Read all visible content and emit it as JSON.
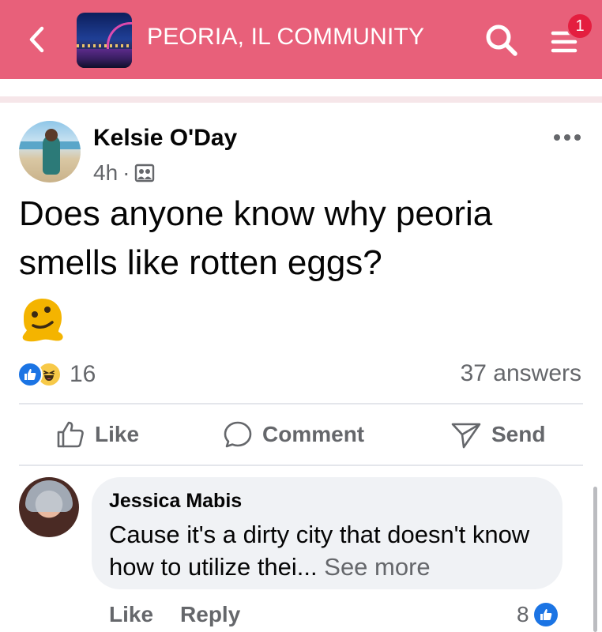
{
  "header": {
    "group_name": "PEORIA, IL COMMUNITY",
    "notification_count": "1",
    "back_icon": "chevron-left-icon",
    "search_icon": "search-icon",
    "menu_icon": "menu-icon",
    "bar_color": "#e8607a"
  },
  "post": {
    "author": "Kelsie O'Day",
    "time": "4h",
    "separator": "·",
    "privacy_icon": "group-members-icon",
    "more_icon": "more-dots-icon",
    "text": "Does anyone know why peoria smells like rotten eggs?",
    "emoji": "melting-face-emoji",
    "reaction_icons": [
      "like-icon",
      "haha-icon"
    ],
    "reaction_count": "16",
    "answers": "37 answers",
    "actions": {
      "like": "Like",
      "comment": "Comment",
      "send": "Send"
    }
  },
  "comment": {
    "author": "Jessica Mabis",
    "text": "Cause it's a dirty city that doesn't know how to utilize thei...",
    "see_more": "See more",
    "like": "Like",
    "reply": "Reply",
    "reaction_count": "8",
    "reaction_icon": "like-icon"
  },
  "colors": {
    "accent_blue": "#1b74e4",
    "muted_text": "#65676b",
    "bubble_bg": "#f0f2f5"
  }
}
